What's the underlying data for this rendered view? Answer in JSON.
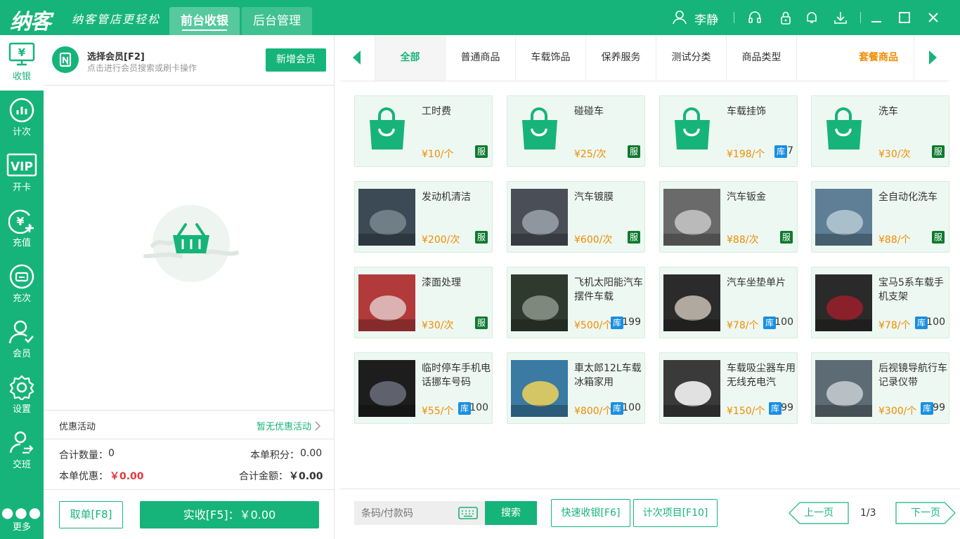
{
  "app": {
    "logo": "纳客",
    "slogan": "纳客管店更轻松"
  },
  "tabs": [
    {
      "label": "前台收银"
    },
    {
      "label": "后台管理"
    }
  ],
  "user": {
    "name": "李静"
  },
  "sidebar": {
    "items": [
      {
        "label": "收银"
      },
      {
        "label": "计次"
      },
      {
        "label": "开卡"
      },
      {
        "label": "充值"
      },
      {
        "label": "充次"
      },
      {
        "label": "会员"
      },
      {
        "label": "设置"
      },
      {
        "label": "交班"
      },
      {
        "label": "更多"
      }
    ],
    "vip_text": "VIP"
  },
  "member": {
    "title": "选择会员[F2]",
    "subtitle": "点击进行会员搜索或刷卡操作",
    "add_button": "新增会员"
  },
  "promo": {
    "label": "优惠活动",
    "value": "暂无优惠活动"
  },
  "summary": {
    "qty_label": "合计数量：",
    "qty": "0",
    "points_label": "本单积分：",
    "points": "0.00",
    "discount_label": "本单优惠：",
    "discount": "￥0.00",
    "total_label": "合计金额：",
    "total": "￥0.00"
  },
  "actions": {
    "cancel": "取单[F8]",
    "pay": "实收[F5]：￥0.00"
  },
  "categories": [
    {
      "label": "全部"
    },
    {
      "label": "普通商品"
    },
    {
      "label": "车载饰品"
    },
    {
      "label": "保养服务"
    },
    {
      "label": "测试分类"
    },
    {
      "label": "商品类型"
    },
    {
      "label": "套餐商品"
    }
  ],
  "products": [
    {
      "name": "工时费",
      "price": "¥10/个",
      "badge": "服",
      "stock": ""
    },
    {
      "name": "碰碰车",
      "price": "¥25/次",
      "badge": "服",
      "stock": ""
    },
    {
      "name": "车载挂饰",
      "price": "¥198/个",
      "badge": "库",
      "stock": "7"
    },
    {
      "name": "洗车",
      "price": "¥30/次",
      "badge": "服",
      "stock": ""
    },
    {
      "name": "发动机清洁",
      "price": "¥200/次",
      "badge": "服",
      "stock": ""
    },
    {
      "name": "汽车镀膜",
      "price": "¥600/次",
      "badge": "服",
      "stock": ""
    },
    {
      "name": "汽车钣金",
      "price": "¥88/次",
      "badge": "服",
      "stock": ""
    },
    {
      "name": "全自动化洗车",
      "price": "¥88/个",
      "badge": "服",
      "stock": ""
    },
    {
      "name": "漆面处理",
      "price": "¥30/次",
      "badge": "服",
      "stock": ""
    },
    {
      "name": "飞机太阳能汽车摆件车载",
      "price": "¥500/个",
      "badge": "库",
      "stock": "199"
    },
    {
      "name": "汽车坐垫单片",
      "price": "¥78/个",
      "badge": "库",
      "stock": "100"
    },
    {
      "name": "宝马5系车载手机支架",
      "price": "¥78/个",
      "badge": "库",
      "stock": "100"
    },
    {
      "name": "临时停车手机电话挪车号码",
      "price": "¥55/个",
      "badge": "库",
      "stock": "100"
    },
    {
      "name": "車太郎12L车载冰箱家用",
      "price": "¥800/个",
      "badge": "库",
      "stock": "100"
    },
    {
      "name": "车载吸尘器车用无线充电汽",
      "price": "¥150/个",
      "badge": "库",
      "stock": "99"
    },
    {
      "name": "后视镜导航行车记录仪带",
      "price": "¥300/个",
      "badge": "库",
      "stock": "99"
    }
  ],
  "bottom": {
    "search_placeholder": "条码/付款码",
    "search_button": "搜索",
    "quick_button": "快速收银[F6]",
    "count_button": "计次项目[F10]",
    "prev": "上一页",
    "page": "1/3",
    "next": "下一页"
  },
  "colors": {
    "brand": "#16b47a",
    "price": "#f08c00",
    "service_badge": "#0e7a2f",
    "stock_badge": "#1a8fe0",
    "red": "#e4393c"
  }
}
